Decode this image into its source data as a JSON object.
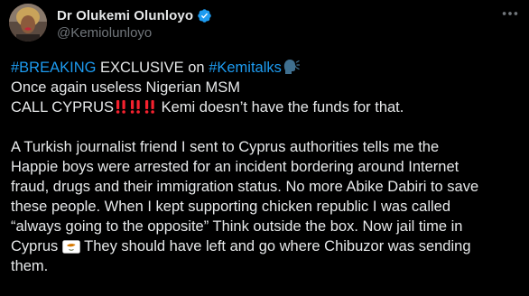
{
  "author": {
    "display_name": "Dr Olukemi Olunloyo",
    "handle": "@Kemiolunloyo",
    "verified": true
  },
  "icons": {
    "verified": "verified-badge-icon",
    "more": "more-options-icon",
    "speaking_head": "speaking-head-icon",
    "exclamation": "double-exclamation-icon",
    "flag": "cyprus-flag-icon"
  },
  "colors": {
    "background": "#000000",
    "text": "#e7e9ea",
    "muted": "#71767b",
    "link": "#1d9bf0",
    "verified": "#1d9bf0",
    "alert": "#f4212e"
  },
  "tweet": {
    "line1": {
      "hashtag1": "#BREAKING",
      "text1": " EXCLUSIVE on ",
      "hashtag2": "#Kemitalks"
    },
    "line2": "Once again useless Nigerian MSM",
    "line3": {
      "before": "CALL CYPRUS",
      "after": " Kemi doesn’t have the funds for that."
    },
    "para_lines": [
      "A Turkish journalist friend I sent to Cyprus authorities tells me the",
      "Happie boys were arrested for an incident bordering around Internet",
      "fraud, drugs and their immigration status. No more Abike Dabiri to save",
      "these people. When I kept supporting chicken republic I was called",
      "“always going to the opposite” Think outside the box. Now jail time in"
    ],
    "line_flag": {
      "before": "Cyprus ",
      "after": " They should have left and go where Chibuzor was sending"
    },
    "last_line": "them."
  }
}
